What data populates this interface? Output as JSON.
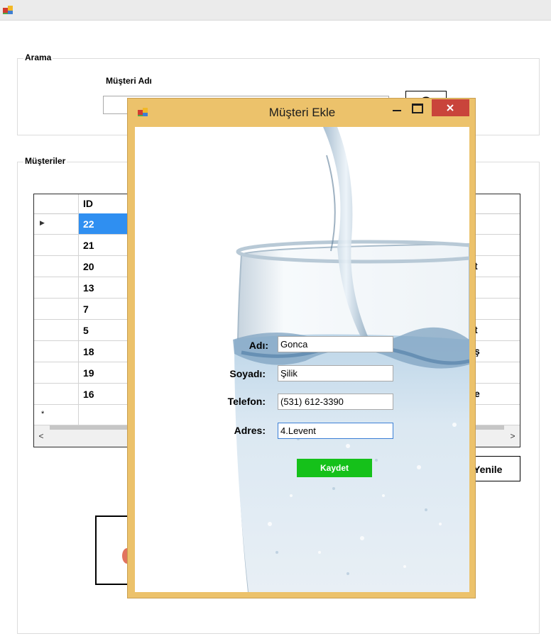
{
  "main_window": {
    "search_group": {
      "title": "Arama",
      "customer_name_label": "Müşteri Adı",
      "search_value": ""
    },
    "customers_group": {
      "title": "Müşteriler"
    },
    "grid": {
      "columns": [
        "ID"
      ],
      "rows": [
        {
          "id": "22",
          "partial": ""
        },
        {
          "id": "21",
          "partial": ""
        },
        {
          "id": "20",
          "partial": "t"
        },
        {
          "id": "13",
          "partial": ""
        },
        {
          "id": "7",
          "partial": ""
        },
        {
          "id": "5",
          "partial": "t"
        },
        {
          "id": "18",
          "partial": "ş"
        },
        {
          "id": "19",
          "partial": ""
        },
        {
          "id": "16",
          "partial": "e"
        }
      ],
      "new_row_marker": "*",
      "selected_row_marker": "▶",
      "scroll_left": "<",
      "scroll_right": ">"
    },
    "refresh_button": "Yenile"
  },
  "dialog": {
    "title": "Müşteri Ekle",
    "minimize_icon": "minimize-icon",
    "maximize_icon": "maximize-icon",
    "close_icon": "close-icon",
    "fields": {
      "name_label": "Adı:",
      "name_value": "Gonca",
      "surname_label": "Soyadı:",
      "surname_value": "Şilik",
      "phone_label": "Telefon:",
      "phone_value": "(531) 612-3390",
      "address_label": "Adres:",
      "address_value": "4.Levent"
    },
    "save_button": "Kaydet"
  },
  "colors": {
    "dialog_frame": "#ecc26b",
    "close_button": "#c9443b",
    "selected_cell": "#2f8ff1",
    "save_button": "#15c11a"
  }
}
